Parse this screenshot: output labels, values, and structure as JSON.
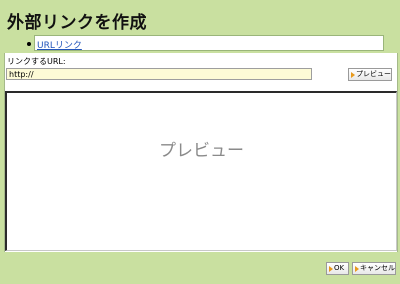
{
  "dialog": {
    "title": "外部リンクを作成"
  },
  "link_type": {
    "label": "URLリンク"
  },
  "url_field": {
    "label": "リンクするURL:",
    "value": "http://"
  },
  "buttons": {
    "preview": "プレビュー",
    "ok": "OK",
    "cancel": "キャンセル"
  },
  "preview": {
    "placeholder": "プレビュー"
  },
  "colors": {
    "background": "#c9e0a0",
    "input_background": "#fdfbd6",
    "button_arrow": "#e89a1c",
    "link": "#2255bb"
  }
}
